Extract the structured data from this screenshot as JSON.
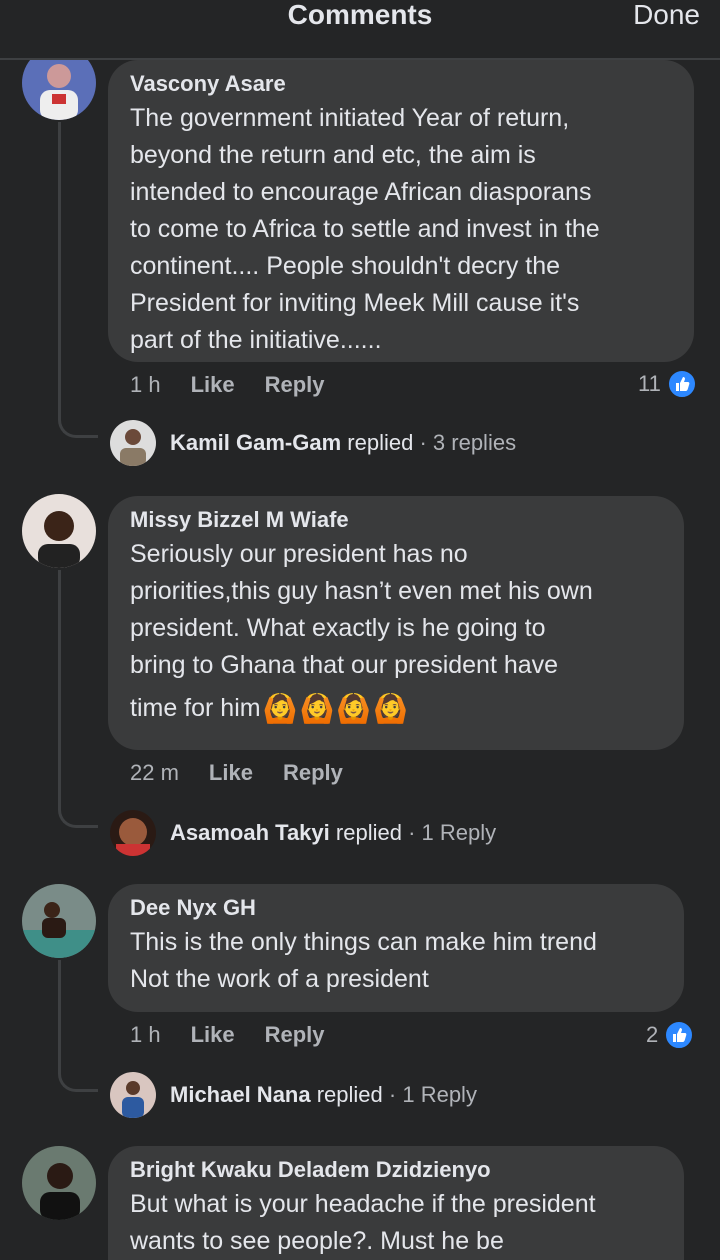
{
  "header": {
    "title": "Comments",
    "done_label": "Done"
  },
  "comments": [
    {
      "author": "Vascony Asare",
      "lines": [
        "The government initiated Year of return,",
        "beyond the return and etc,  the aim is",
        "intended to encourage African diasporans",
        "to come to Africa to settle and invest in the",
        "continent.... People shouldn't decry the",
        "President for inviting Meek Mill cause it's",
        "part of the initiative......"
      ],
      "time": "1 h",
      "like_label": "Like",
      "reply_label": "Reply",
      "like_count": "11",
      "reply_author": "Kamil Gam-Gam",
      "replied_word": "replied",
      "reply_count": "· 3 replies"
    },
    {
      "author": "Missy Bizzel M Wiafe",
      "lines": [
        "Seriously our president has no",
        "priorities,this guy hasn’t even met his own",
        "president. What exactly is he going to",
        "bring to Ghana that our president have",
        "time for him"
      ],
      "emoji": [
        "🙆",
        "🙆",
        "🙆",
        "🙆"
      ],
      "time": "22 m",
      "like_label": "Like",
      "reply_label": "Reply",
      "reply_author": "Asamoah Takyi",
      "replied_word": "replied",
      "reply_count": "· 1 Reply"
    },
    {
      "author": "Dee Nyx GH",
      "lines": [
        "This is the only things can make him trend",
        "Not the work of a president"
      ],
      "time": "1 h",
      "like_label": "Like",
      "reply_label": "Reply",
      "like_count": "2",
      "reply_author": "Michael Nana",
      "replied_word": "replied",
      "reply_count": "· 1 Reply"
    },
    {
      "author": "Bright Kwaku Deladem Dzidzienyo",
      "lines": [
        "But what is your headache if the president",
        "wants to see people?. Must he be"
      ]
    }
  ],
  "colors": {
    "background": "#242526",
    "bubble": "#3a3b3c",
    "like_blue": "#2d88ff"
  }
}
